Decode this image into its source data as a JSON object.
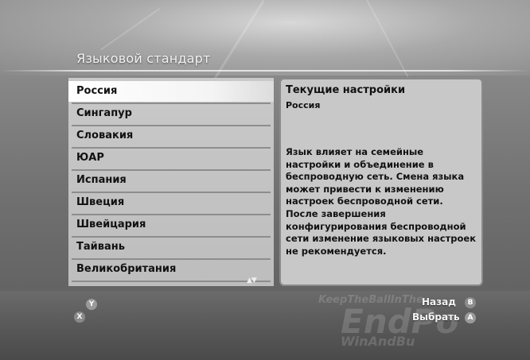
{
  "screen": {
    "title": "Языковой стандарт"
  },
  "list": {
    "items": [
      {
        "label": "Россия",
        "selected": true
      },
      {
        "label": "Сингапур"
      },
      {
        "label": "Словакия"
      },
      {
        "label": "ЮАР"
      },
      {
        "label": "Испания"
      },
      {
        "label": "Швеция"
      },
      {
        "label": "Швейцария"
      },
      {
        "label": "Тайвань"
      },
      {
        "label": "Великобритания"
      }
    ],
    "scroll_indicator": "▲▼"
  },
  "info": {
    "title": "Текущие настройки",
    "value": "Россия",
    "description": "Язык влияет на семейные настройки и объединение в беспроводную сеть. Смена языка может привести к изменению настроек беспроводной сети. После завершения конфигурирования беспроводной сети изменение языковых настроек не рекомендуется."
  },
  "controls": {
    "back_label": "Назад",
    "select_label": "Выбрать",
    "y_button": "Y",
    "x_button": "X",
    "b_button": "B",
    "a_button": "A"
  },
  "background": {
    "watermark_1": "KeepTheBallInThe",
    "watermark_2": "EndPo",
    "watermark_3": "WinAndBu"
  },
  "colors": {
    "selected_bg": "#ffffff",
    "list_bg": "#c4c4c4",
    "info_bg": "#c8c8c8"
  }
}
